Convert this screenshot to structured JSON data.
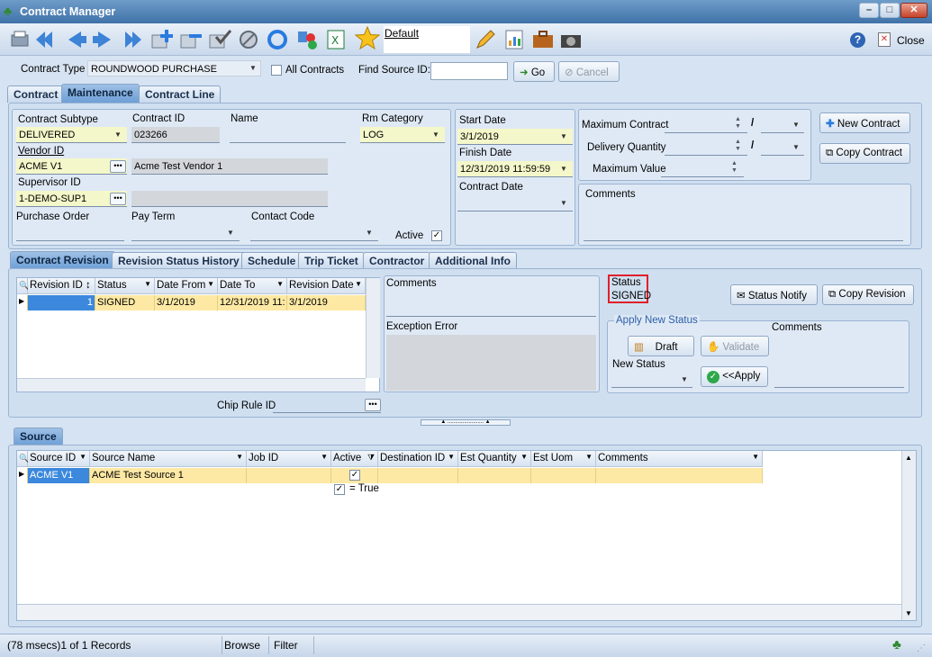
{
  "window": {
    "title": "Contract Manager",
    "close_label": "Close"
  },
  "toolbar": {
    "default_link": "Default"
  },
  "filter": {
    "contract_type_label": "Contract Type",
    "contract_type_value": "ROUNDWOOD PURCHASE",
    "all_contracts_label": "All Contracts",
    "find_source_label": "Find Source ID:",
    "go_label": "Go",
    "cancel_label": "Cancel"
  },
  "main_tabs": [
    "Contract",
    "Maintenance",
    "Contract Line"
  ],
  "contract": {
    "subtype_label": "Contract Subtype",
    "subtype_value": "DELIVERED",
    "id_label": "Contract ID",
    "id_value": "023266",
    "name_label": "Name",
    "rm_category_label": "Rm Category",
    "rm_category_value": "LOG",
    "vendor_label": "Vendor ID",
    "vendor_value": "ACME V1",
    "vendor_name": "Acme Test Vendor 1",
    "supervisor_label": "Supervisor ID",
    "supervisor_value": "1-DEMO-SUP1",
    "po_label": "Purchase Order",
    "pay_term_label": "Pay Term",
    "contact_label": "Contact Code",
    "active_label": "Active",
    "start_label": "Start Date",
    "start_value": "3/1/2019",
    "finish_label": "Finish Date",
    "finish_value": "12/31/2019 11:59:59",
    "contract_date_label": "Contract Date",
    "max_contract_label": "Maximum Contract",
    "delivery_qty_label": "Delivery Quantity",
    "max_value_label": "Maximum Value",
    "slash": "/",
    "comments_label": "Comments",
    "new_contract_label": "New Contract",
    "copy_contract_label": "Copy Contract"
  },
  "sub_tabs": [
    "Contract Revision",
    "Revision Status History",
    "Schedule",
    "Trip Ticket",
    "Contractor",
    "Additional Info"
  ],
  "revision": {
    "columns": [
      "Revision ID",
      "Status",
      "Date From",
      "Date To",
      "Revision Date"
    ],
    "rows": [
      {
        "id": "1",
        "status": "SIGNED",
        "from": "3/1/2019",
        "to": "12/31/2019 11:",
        "date": "3/1/2019"
      }
    ],
    "comments_label": "Comments",
    "exception_label": "Exception Error",
    "status_label": "Status",
    "status_value": "SIGNED",
    "status_notify_label": "Status Notify",
    "copy_revision_label": "Copy Revision",
    "apply_group_label": "Apply New Status",
    "apply_comments_label": "Comments",
    "draft_label": "Draft",
    "validate_label": "Validate",
    "new_status_label": "New Status",
    "apply_label": "<<Apply",
    "chip_rule_label": "Chip Rule ID"
  },
  "source": {
    "tab_label": "Source",
    "columns": [
      "Source ID",
      "Source Name",
      "Job ID",
      "Active",
      "Destination ID",
      "Est Quantity",
      "Est Uom",
      "Comments"
    ],
    "rows": [
      {
        "id": "ACME V1",
        "name": "ACME Test Source 1",
        "job": "",
        "active": "✓",
        "dest": "",
        "qty": "",
        "uom": "",
        "comments": ""
      }
    ],
    "filter_text": "= True"
  },
  "statusbar": {
    "records": "(78 msecs)1 of 1 Records",
    "browse": "Browse",
    "filter": "Filter"
  }
}
